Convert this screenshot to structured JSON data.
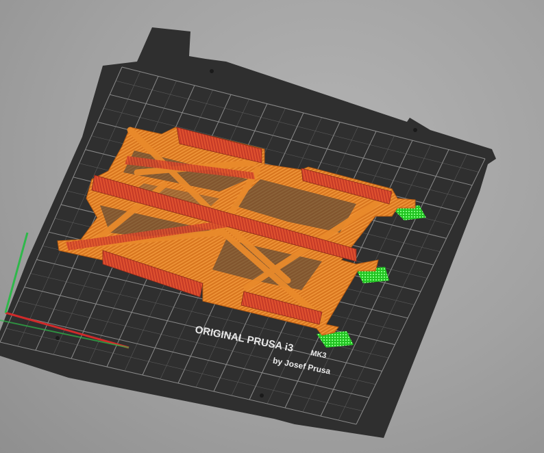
{
  "app": {
    "view": "3D plater preview",
    "background_color": "#a8a8a8"
  },
  "bed": {
    "brand_line": "ORIGINAL PRUSA i3",
    "model_suffix": "MK3",
    "byline": "by Josef Prusa",
    "plate_color": "#2f2f2f",
    "grid_color": "#8a8a8a",
    "label_color": "#e8e8e8"
  },
  "axes": {
    "x_axis": {
      "name": "X",
      "color": "#d12a2a"
    },
    "y_axis": {
      "name": "Y",
      "color": "#2fb84a"
    }
  },
  "model": {
    "description": "printed truss part",
    "primary_color": "#e07a22",
    "top_surface_color": "#c83a2a",
    "support_color": "#2dcf2d",
    "support_pads": 3
  }
}
